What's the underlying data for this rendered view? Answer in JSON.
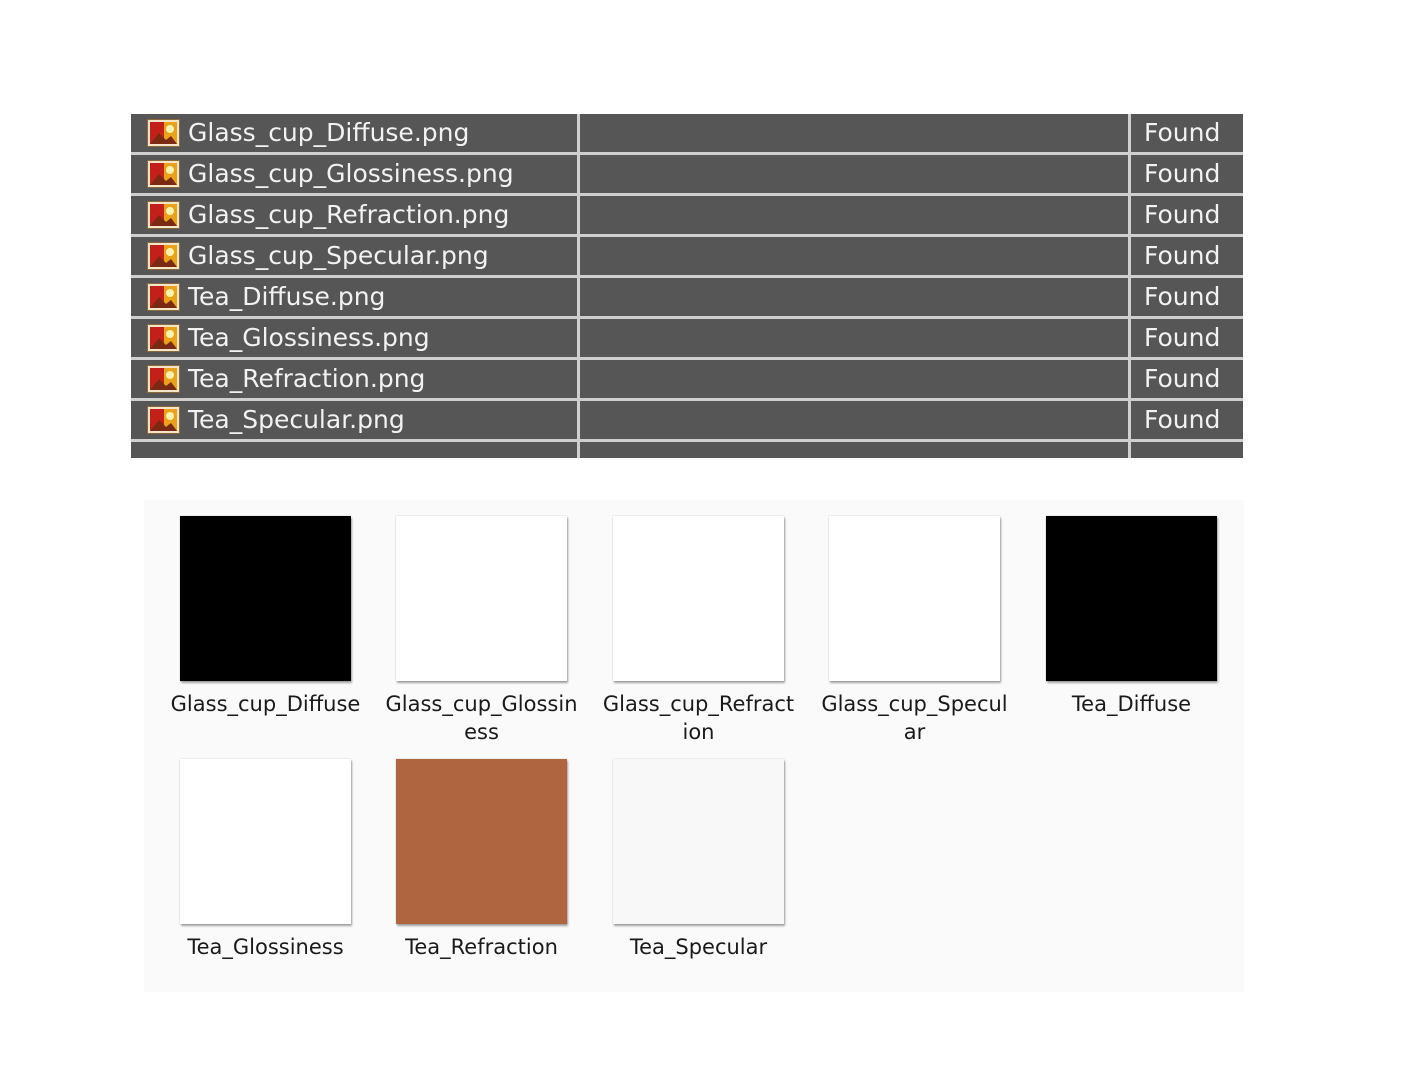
{
  "asset_list": {
    "rows": [
      {
        "file": "Glass_cup_Diffuse.png",
        "status": "Found"
      },
      {
        "file": "Glass_cup_Glossiness.png",
        "status": "Found"
      },
      {
        "file": "Glass_cup_Refraction.png",
        "status": "Found"
      },
      {
        "file": "Glass_cup_Specular.png",
        "status": "Found"
      },
      {
        "file": "Tea_Diffuse.png",
        "status": "Found"
      },
      {
        "file": "Tea_Glossiness.png",
        "status": "Found"
      },
      {
        "file": "Tea_Refraction.png",
        "status": "Found"
      },
      {
        "file": "Tea_Specular.png",
        "status": "Found"
      }
    ]
  },
  "thumbnails": {
    "items": [
      {
        "label": "Glass_cup_Diffuse",
        "color": "#000000"
      },
      {
        "label": "Glass_cup_Glossiness",
        "color": "#ffffff"
      },
      {
        "label": "Glass_cup_Refraction",
        "color": "#ffffff"
      },
      {
        "label": "Glass_cup_Specular",
        "color": "#ffffff"
      },
      {
        "label": "Tea_Diffuse",
        "color": "#000000"
      },
      {
        "label": "Tea_Glossiness",
        "color": "#ffffff"
      },
      {
        "label": "Tea_Refraction",
        "color": "#ae6540"
      },
      {
        "label": "Tea_Specular",
        "color": "#f8f8f8"
      }
    ]
  },
  "icons": {
    "file_icon": "image-file-icon"
  }
}
